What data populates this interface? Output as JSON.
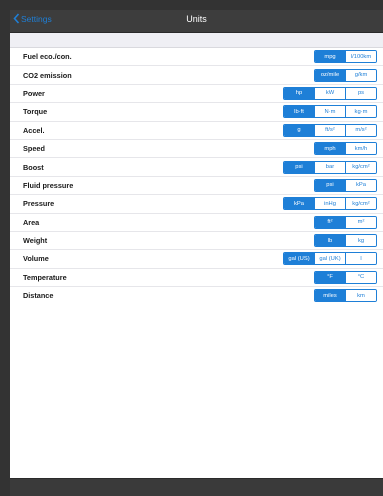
{
  "nav": {
    "title": "Units",
    "back_label": "Settings"
  },
  "rows": [
    {
      "label": "Fuel eco./con.",
      "options": [
        "mpg",
        "l/100km"
      ],
      "selected": 0
    },
    {
      "label": "CO2 emission",
      "options": [
        "oz/mile",
        "g/km"
      ],
      "selected": 0
    },
    {
      "label": "Power",
      "options": [
        "hp",
        "kW",
        "ps"
      ],
      "selected": 0
    },
    {
      "label": "Torque",
      "options": [
        "lb·ft",
        "N·m",
        "kg·m"
      ],
      "selected": 0
    },
    {
      "label": "Accel.",
      "options": [
        "g",
        "ft/s²",
        "m/s²"
      ],
      "selected": 0
    },
    {
      "label": "Speed",
      "options": [
        "mph",
        "km/h"
      ],
      "selected": 0
    },
    {
      "label": "Boost",
      "options": [
        "psi",
        "bar",
        "kg/cm²"
      ],
      "selected": 0
    },
    {
      "label": "Fluid pressure",
      "options": [
        "psi",
        "kPa"
      ],
      "selected": 0
    },
    {
      "label": "Pressure",
      "options": [
        "kPa",
        "inHg",
        "kg/cm²"
      ],
      "selected": 0
    },
    {
      "label": "Area",
      "options": [
        "ft²",
        "m²"
      ],
      "selected": 0
    },
    {
      "label": "Weight",
      "options": [
        "lb",
        "kg"
      ],
      "selected": 0
    },
    {
      "label": "Volume",
      "options": [
        "gal (US)",
        "gal (UK)",
        "l"
      ],
      "selected": 0
    },
    {
      "label": "Temperature",
      "options": [
        "°F",
        "°C"
      ],
      "selected": 0
    },
    {
      "label": "Distance",
      "options": [
        "miles",
        "km"
      ],
      "selected": 0
    }
  ],
  "colors": {
    "accent": "#1e7fd7",
    "nav_bg": "#3d3d3d",
    "chrome_bg": "#333333"
  },
  "icons": {
    "back": "chevron-left-icon"
  }
}
